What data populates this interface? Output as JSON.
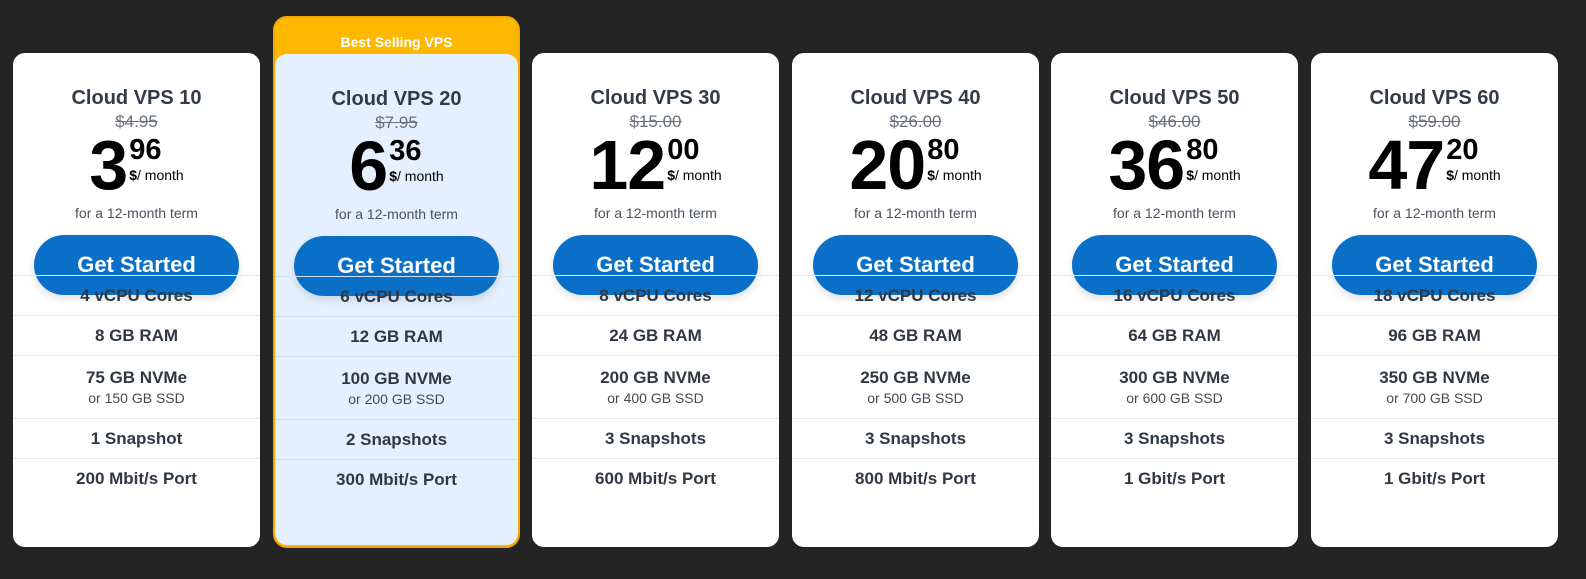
{
  "featured_badge": "Best Selling VPS",
  "plans": [
    {
      "name": "Cloud VPS 10",
      "old_price": "$4.95",
      "price_int": "3",
      "price_cents": "96",
      "currency": "$",
      "period": "/ month",
      "term": "for a 12-month term",
      "cta": "Get Started",
      "cores": "4 vCPU Cores",
      "ram": "8 GB RAM",
      "storage": "75 GB NVMe",
      "storage_alt": "or 150 GB SSD",
      "snapshots": "1 Snapshot",
      "port": "200 Mbit/s Port"
    },
    {
      "name": "Cloud VPS 20",
      "old_price": "$7.95",
      "price_int": "6",
      "price_cents": "36",
      "currency": "$",
      "period": "/ month",
      "term": "for a 12-month term",
      "cta": "Get Started",
      "cores": "6 vCPU Cores",
      "ram": "12 GB RAM",
      "storage": "100 GB NVMe",
      "storage_alt": "or 200 GB SSD",
      "snapshots": "2 Snapshots",
      "port": "300 Mbit/s Port"
    },
    {
      "name": "Cloud VPS 30",
      "old_price": "$15.00",
      "price_int": "12",
      "price_cents": "00",
      "currency": "$",
      "period": "/ month",
      "term": "for a 12-month term",
      "cta": "Get Started",
      "cores": "8 vCPU Cores",
      "ram": "24 GB RAM",
      "storage": "200 GB NVMe",
      "storage_alt": "or 400 GB SSD",
      "snapshots": "3 Snapshots",
      "port": "600 Mbit/s Port"
    },
    {
      "name": "Cloud VPS 40",
      "old_price": "$26.00",
      "price_int": "20",
      "price_cents": "80",
      "currency": "$",
      "period": "/ month",
      "term": "for a 12-month term",
      "cta": "Get Started",
      "cores": "12 vCPU Cores",
      "ram": "48 GB RAM",
      "storage": "250 GB NVMe",
      "storage_alt": "or 500 GB SSD",
      "snapshots": "3 Snapshots",
      "port": "800 Mbit/s Port"
    },
    {
      "name": "Cloud VPS 50",
      "old_price": "$46.00",
      "price_int": "36",
      "price_cents": "80",
      "currency": "$",
      "period": "/ month",
      "term": "for a 12-month term",
      "cta": "Get Started",
      "cores": "16 vCPU Cores",
      "ram": "64 GB RAM",
      "storage": "300 GB NVMe",
      "storage_alt": "or 600 GB SSD",
      "snapshots": "3 Snapshots",
      "port": "1 Gbit/s Port"
    },
    {
      "name": "Cloud VPS 60",
      "old_price": "$59.00",
      "price_int": "47",
      "price_cents": "20",
      "currency": "$",
      "period": "/ month",
      "term": "for a 12-month term",
      "cta": "Get Started",
      "cores": "18 vCPU Cores",
      "ram": "96 GB RAM",
      "storage": "350 GB NVMe",
      "storage_alt": "or 700 GB SSD",
      "snapshots": "3 Snapshots",
      "port": "1 Gbit/s Port"
    }
  ]
}
